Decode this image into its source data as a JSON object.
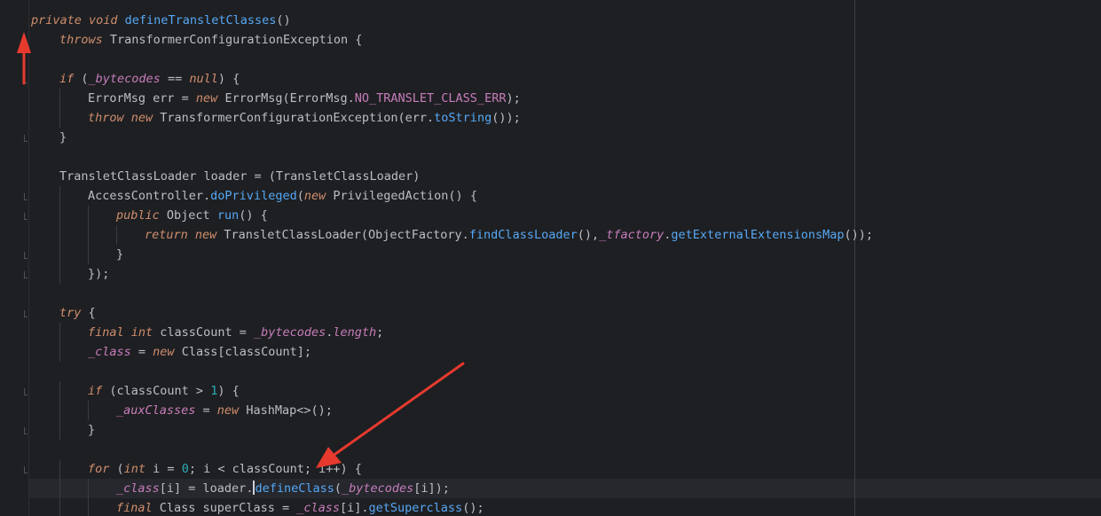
{
  "palette": {
    "background": "#1e1f22",
    "current_line": "#26282e",
    "keyword": "#cf8e6d",
    "method": "#56a8f5",
    "field": "#c77dbb",
    "default_text": "#bcbec4",
    "number": "#2aacb8",
    "constant": "#c77dbb",
    "annotation_arrow": "#e63a2e"
  },
  "code_lines": [
    {
      "indent": 0,
      "fold": false,
      "tokens": [
        {
          "t": "private ",
          "c": "kw-i"
        },
        {
          "t": "void ",
          "c": "kw-i"
        },
        {
          "t": "defineTransletClasses",
          "c": "fn"
        },
        {
          "t": "()",
          "c": "txt"
        }
      ]
    },
    {
      "indent": 1,
      "fold": true,
      "tokens": [
        {
          "t": "throws ",
          "c": "kw-i"
        },
        {
          "t": "TransformerConfigurationException ",
          "c": "txt"
        },
        {
          "t": "{",
          "c": "brace"
        }
      ]
    },
    {
      "indent": 0,
      "fold": false,
      "tokens": []
    },
    {
      "indent": 1,
      "fold": true,
      "tokens": [
        {
          "t": "if ",
          "c": "kw-i"
        },
        {
          "t": "(",
          "c": "txt"
        },
        {
          "t": "_bytecodes",
          "c": "field"
        },
        {
          "t": " == ",
          "c": "txt"
        },
        {
          "t": "null",
          "c": "kw-i"
        },
        {
          "t": ") ",
          "c": "txt"
        },
        {
          "t": "{",
          "c": "brace"
        }
      ]
    },
    {
      "indent": 2,
      "fold": false,
      "tokens": [
        {
          "t": "ErrorMsg err = ",
          "c": "txt"
        },
        {
          "t": "new ",
          "c": "kw-i"
        },
        {
          "t": "ErrorMsg",
          "c": "txt"
        },
        {
          "t": "(",
          "c": "txt"
        },
        {
          "t": "ErrorMsg.",
          "c": "txt"
        },
        {
          "t": "NO_TRANSLET_CLASS_ERR",
          "c": "const"
        },
        {
          "t": ");",
          "c": "txt"
        }
      ]
    },
    {
      "indent": 2,
      "fold": false,
      "tokens": [
        {
          "t": "throw ",
          "c": "kw-i"
        },
        {
          "t": "new ",
          "c": "kw-i"
        },
        {
          "t": "TransformerConfigurationException",
          "c": "txt"
        },
        {
          "t": "(",
          "c": "brace"
        },
        {
          "t": "err.",
          "c": "txt"
        },
        {
          "t": "toString",
          "c": "fn"
        },
        {
          "t": "())",
          "c": "brace"
        },
        {
          "t": ";",
          "c": "txt"
        }
      ]
    },
    {
      "indent": 1,
      "fold": true,
      "tokens": [
        {
          "t": "}",
          "c": "brace"
        }
      ]
    },
    {
      "indent": 0,
      "fold": false,
      "tokens": []
    },
    {
      "indent": 1,
      "fold": false,
      "tokens": [
        {
          "t": "TransletClassLoader loader = (TransletClassLoader)",
          "c": "txt"
        }
      ]
    },
    {
      "indent": 2,
      "fold": true,
      "tokens": [
        {
          "t": "AccessController.",
          "c": "txt"
        },
        {
          "t": "doPrivileged",
          "c": "fn"
        },
        {
          "t": "(",
          "c": "txt"
        },
        {
          "t": "new ",
          "c": "kw-i"
        },
        {
          "t": "PrivilegedAction",
          "c": "txt"
        },
        {
          "t": "() ",
          "c": "txt"
        },
        {
          "t": "{",
          "c": "brace"
        }
      ]
    },
    {
      "indent": 3,
      "fold": true,
      "tokens": [
        {
          "t": "public ",
          "c": "kw-i"
        },
        {
          "t": "Object ",
          "c": "txt"
        },
        {
          "t": "run",
          "c": "fn"
        },
        {
          "t": "() ",
          "c": "txt"
        },
        {
          "t": "{",
          "c": "brace"
        }
      ]
    },
    {
      "indent": 4,
      "fold": false,
      "tokens": [
        {
          "t": "return ",
          "c": "kw-i"
        },
        {
          "t": "new ",
          "c": "kw-i"
        },
        {
          "t": "TransletClassLoader",
          "c": "txt"
        },
        {
          "t": "(",
          "c": "brace"
        },
        {
          "t": "ObjectFactory.",
          "c": "txt"
        },
        {
          "t": "findClassLoader",
          "c": "fn"
        },
        {
          "t": "()",
          "c": "brace"
        },
        {
          "t": ",",
          "c": "txt"
        },
        {
          "t": "_tfactory",
          "c": "field"
        },
        {
          "t": ".",
          "c": "txt"
        },
        {
          "t": "getExternalExtensionsMap",
          "c": "fn"
        },
        {
          "t": "())",
          "c": "brace"
        },
        {
          "t": ";",
          "c": "txt"
        }
      ]
    },
    {
      "indent": 3,
      "fold": true,
      "tokens": [
        {
          "t": "}",
          "c": "brace"
        }
      ]
    },
    {
      "indent": 2,
      "fold": true,
      "tokens": [
        {
          "t": "})",
          "c": "brace"
        },
        {
          "t": ";",
          "c": "txt"
        }
      ]
    },
    {
      "indent": 0,
      "fold": false,
      "tokens": []
    },
    {
      "indent": 1,
      "fold": true,
      "tokens": [
        {
          "t": "try ",
          "c": "kw-i"
        },
        {
          "t": "{",
          "c": "brace"
        }
      ]
    },
    {
      "indent": 2,
      "fold": false,
      "tokens": [
        {
          "t": "final ",
          "c": "kw-i"
        },
        {
          "t": "int ",
          "c": "kw-i"
        },
        {
          "t": "classCount = ",
          "c": "txt"
        },
        {
          "t": "_bytecodes",
          "c": "field"
        },
        {
          "t": ".",
          "c": "txt"
        },
        {
          "t": "length",
          "c": "field"
        },
        {
          "t": ";",
          "c": "txt"
        }
      ]
    },
    {
      "indent": 2,
      "fold": false,
      "tokens": [
        {
          "t": "_class",
          "c": "field"
        },
        {
          "t": " = ",
          "c": "txt"
        },
        {
          "t": "new ",
          "c": "kw-i"
        },
        {
          "t": "Class[classCount];",
          "c": "txt"
        }
      ]
    },
    {
      "indent": 0,
      "fold": false,
      "tokens": []
    },
    {
      "indent": 2,
      "fold": true,
      "tokens": [
        {
          "t": "if ",
          "c": "kw-i"
        },
        {
          "t": "(classCount > ",
          "c": "txt"
        },
        {
          "t": "1",
          "c": "num"
        },
        {
          "t": ") ",
          "c": "txt"
        },
        {
          "t": "{",
          "c": "brace"
        }
      ]
    },
    {
      "indent": 3,
      "fold": false,
      "tokens": [
        {
          "t": "_auxClasses",
          "c": "field"
        },
        {
          "t": " = ",
          "c": "txt"
        },
        {
          "t": "new ",
          "c": "kw-i"
        },
        {
          "t": "HashMap<>",
          "c": "txt"
        },
        {
          "t": "()",
          "c": "brace"
        },
        {
          "t": ";",
          "c": "txt"
        }
      ]
    },
    {
      "indent": 2,
      "fold": true,
      "tokens": [
        {
          "t": "}",
          "c": "brace"
        }
      ]
    },
    {
      "indent": 0,
      "fold": false,
      "tokens": []
    },
    {
      "indent": 2,
      "fold": true,
      "tokens": [
        {
          "t": "for ",
          "c": "kw-i"
        },
        {
          "t": "(",
          "c": "txt"
        },
        {
          "t": "int ",
          "c": "kw-i"
        },
        {
          "t": "i = ",
          "c": "txt"
        },
        {
          "t": "0",
          "c": "num"
        },
        {
          "t": "; i < classCount; i++) ",
          "c": "txt"
        },
        {
          "t": "{",
          "c": "brace"
        }
      ]
    },
    {
      "indent": 3,
      "fold": false,
      "caret_after": 3,
      "tokens": [
        {
          "t": "_class",
          "c": "field"
        },
        {
          "t": "[i] = loader.",
          "c": "txt"
        },
        {
          "t": "",
          "c": "txt"
        },
        {
          "t": "defineClass",
          "c": "fn"
        },
        {
          "t": "(",
          "c": "brace"
        },
        {
          "t": "_bytecodes",
          "c": "field"
        },
        {
          "t": "[i])",
          "c": "txt"
        },
        {
          "t": ";",
          "c": "txt"
        }
      ]
    },
    {
      "indent": 3,
      "fold": false,
      "tokens": [
        {
          "t": "final ",
          "c": "kw-i"
        },
        {
          "t": "Class superClass = ",
          "c": "txt"
        },
        {
          "t": "_class",
          "c": "field"
        },
        {
          "t": "[i].",
          "c": "txt"
        },
        {
          "t": "getSuperclass",
          "c": "fn"
        },
        {
          "t": "()",
          "c": "brace"
        },
        {
          "t": ";",
          "c": "txt"
        }
      ]
    }
  ]
}
